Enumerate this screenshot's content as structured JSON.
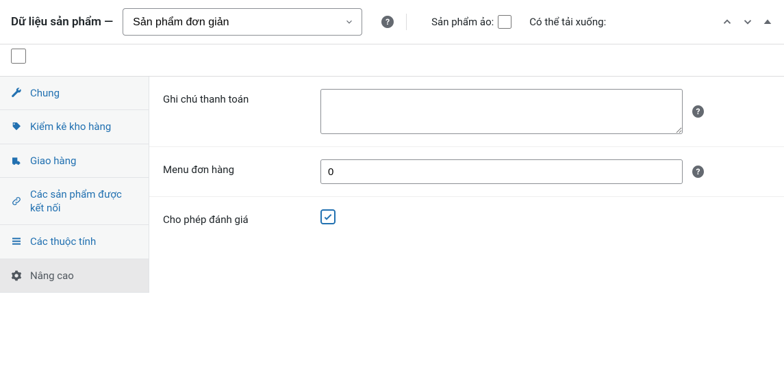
{
  "header": {
    "title": "Dữ liệu sản phẩm —",
    "product_type": "Sản phẩm đơn giản",
    "virtual_label": "Sản phẩm ảo:",
    "downloadable_label": "Có thể tải xuống:"
  },
  "tabs": {
    "general": "Chung",
    "inventory": "Kiểm kê kho hàng",
    "shipping": "Giao hàng",
    "linked": "Các sản phẩm được kết nối",
    "attributes": "Các thuộc tính",
    "advanced": "Nâng cao"
  },
  "form": {
    "purchase_note_label": "Ghi chú thanh toán",
    "purchase_note_value": "",
    "menu_order_label": "Menu đơn hàng",
    "menu_order_value": "0",
    "reviews_label": "Cho phép đánh giá",
    "reviews_checked": true
  }
}
